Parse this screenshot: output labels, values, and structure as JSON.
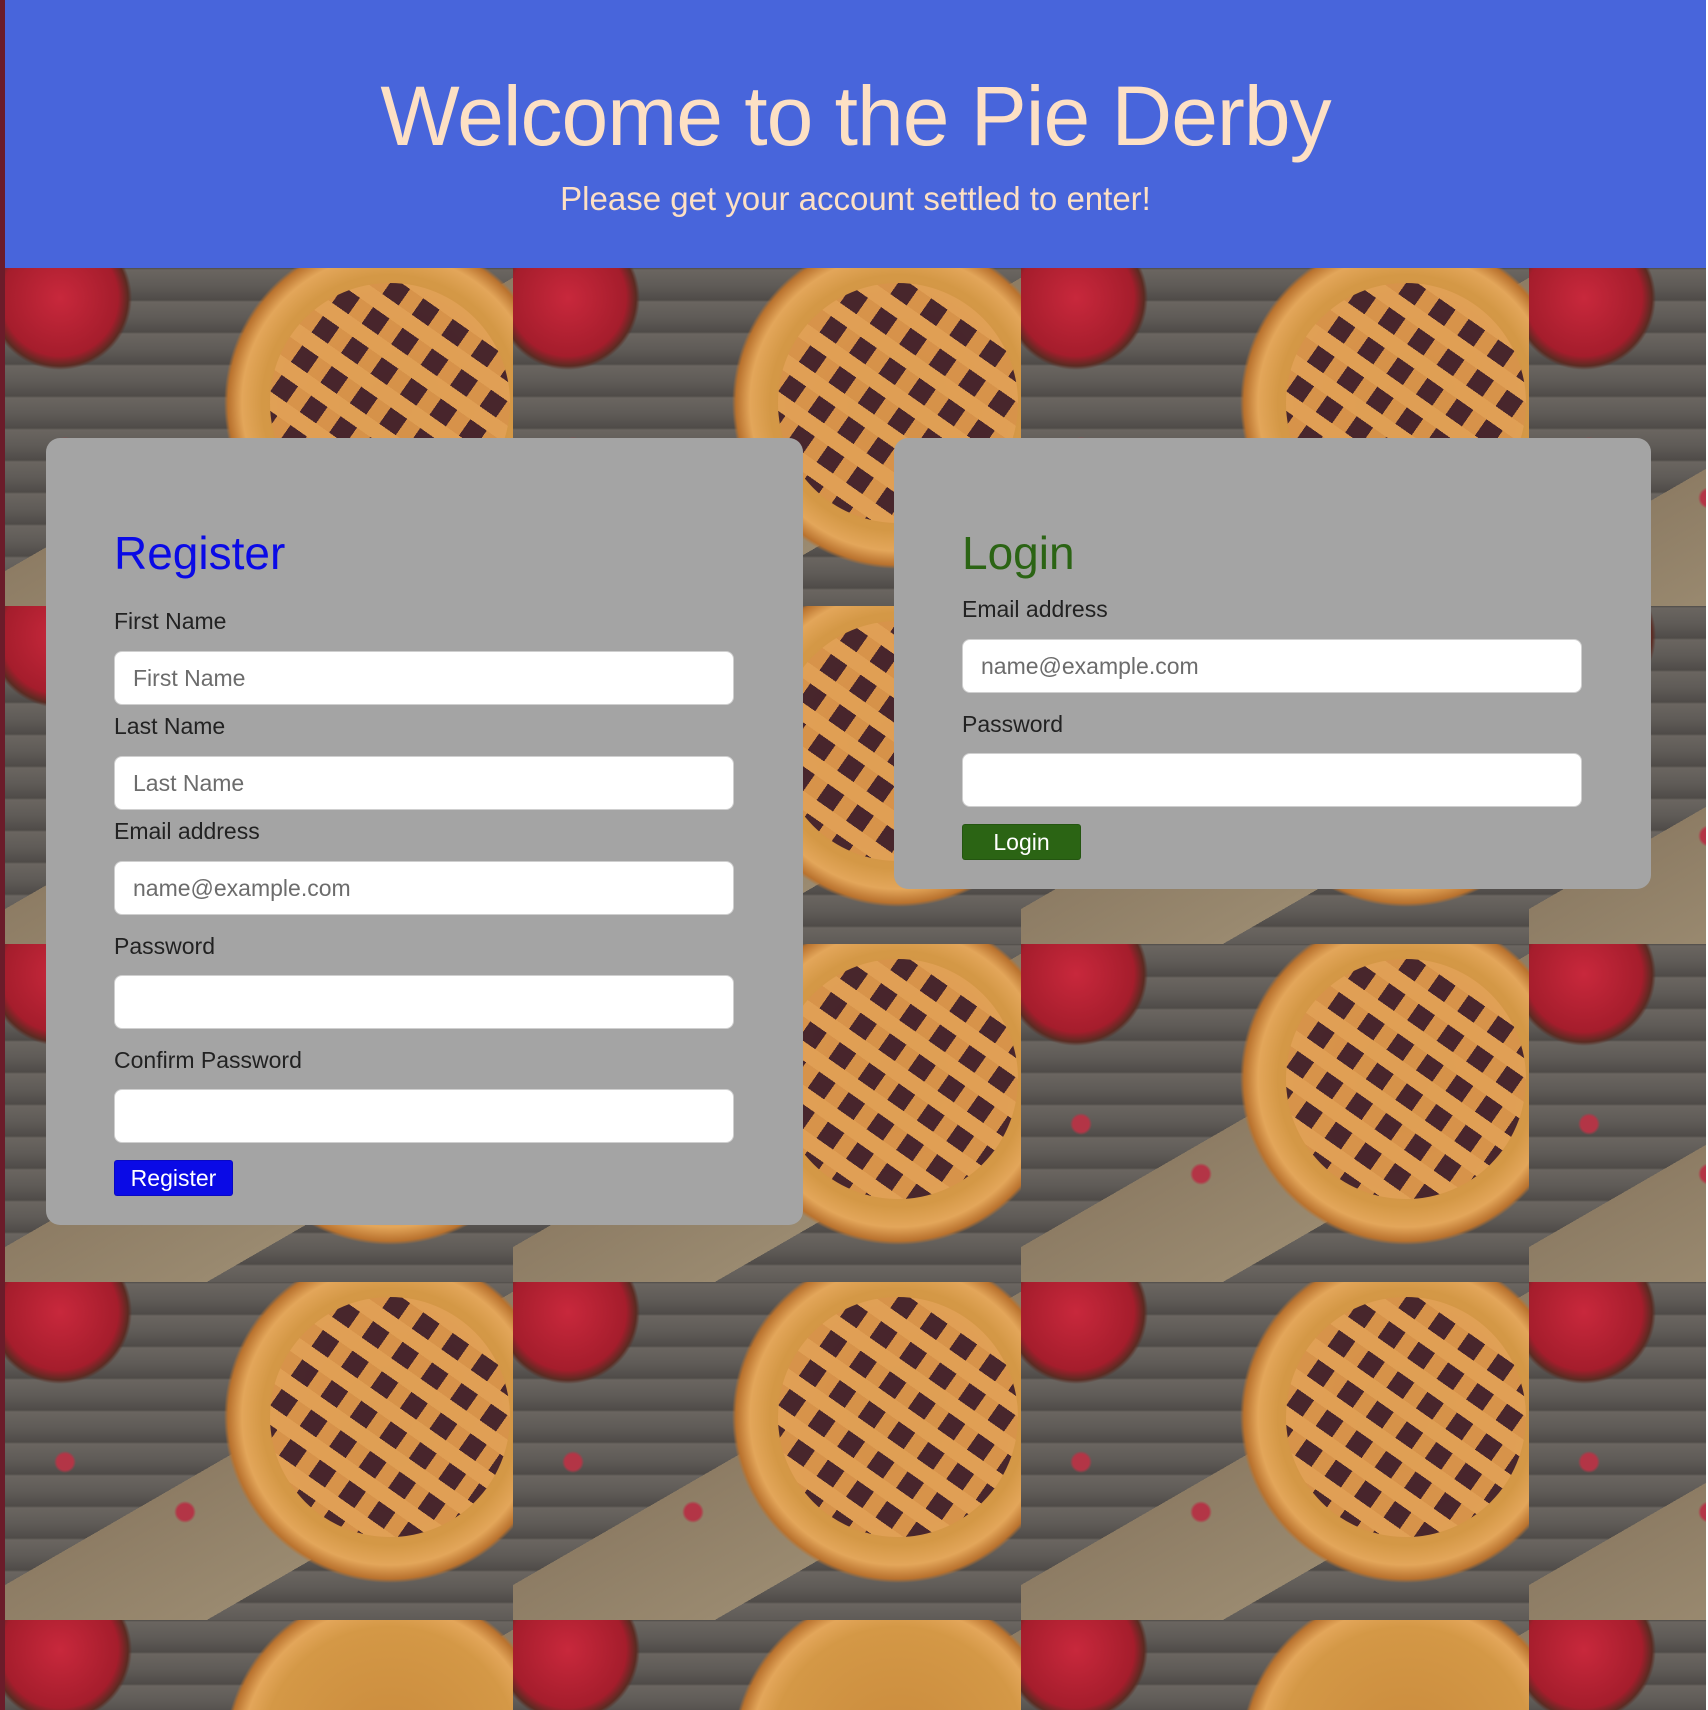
{
  "header": {
    "title": "Welcome to the Pie Derby",
    "subtitle": "Please get your account settled to enter!"
  },
  "register": {
    "heading": "Register",
    "first_name_label": "First Name",
    "first_name_placeholder": "First Name",
    "last_name_label": "Last Name",
    "last_name_placeholder": "Last Name",
    "email_label": "Email address",
    "email_placeholder": "name@example.com",
    "password_label": "Password",
    "confirm_password_label": "Confirm Password",
    "button_label": "Register"
  },
  "login": {
    "heading": "Login",
    "email_label": "Email address",
    "email_placeholder": "name@example.com",
    "password_label": "Password",
    "button_label": "Login"
  },
  "colors": {
    "header_bg": "#4865db",
    "header_text": "#fde0c4",
    "register_accent": "#0a0ae6",
    "login_accent": "#2b6414",
    "card_bg": "#a4a4a4"
  }
}
